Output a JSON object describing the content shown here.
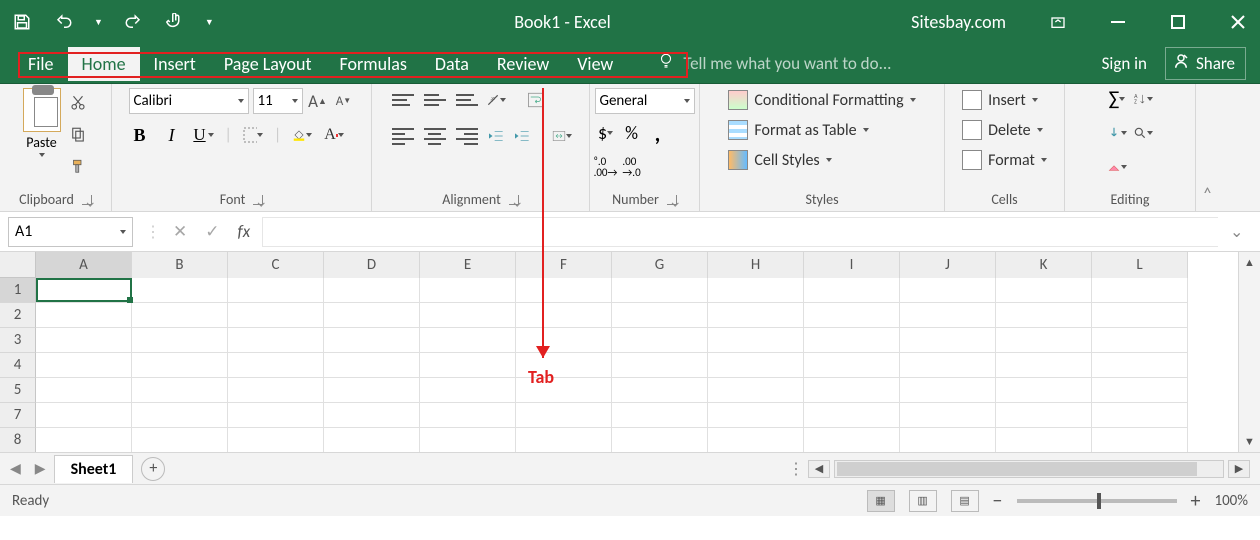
{
  "title_bar": {
    "app_title": "Book1 - Excel",
    "site_label": "Sitesbay.com"
  },
  "ribbon_tabs": {
    "tabs": [
      "File",
      "Home",
      "Insert",
      "Page Layout",
      "Formulas",
      "Data",
      "Review",
      "View"
    ],
    "active_index": 1,
    "tell_me_placeholder": "Tell me what you want to do...",
    "sign_in": "Sign in",
    "share": "Share"
  },
  "ribbon": {
    "clipboard": {
      "paste_label": "Paste",
      "group_label": "Clipboard"
    },
    "font": {
      "font_name": "Calibri",
      "font_size": "11",
      "group_label": "Font"
    },
    "alignment": {
      "group_label": "Alignment"
    },
    "number": {
      "group_label": "Number",
      "format": "General"
    },
    "styles": {
      "group_label": "Styles",
      "conditional": "Conditional Formatting",
      "table": "Format as Table",
      "cell": "Cell Styles"
    },
    "cells": {
      "group_label": "Cells",
      "insert": "Insert",
      "delete": "Delete",
      "format": "Format"
    },
    "editing": {
      "group_label": "Editing"
    }
  },
  "formula_bar": {
    "name_box": "A1",
    "fx_label": "fx"
  },
  "sheet": {
    "columns": [
      "A",
      "B",
      "C",
      "D",
      "E",
      "F",
      "G",
      "H",
      "I",
      "J",
      "K",
      "L"
    ],
    "rows": [
      "1",
      "2",
      "3",
      "4",
      "5",
      "7",
      "8"
    ],
    "active_cell": "A1",
    "sheet_tab": "Sheet1"
  },
  "status_bar": {
    "status": "Ready",
    "zoom": "100%"
  },
  "annotation": {
    "label": "Tab"
  }
}
